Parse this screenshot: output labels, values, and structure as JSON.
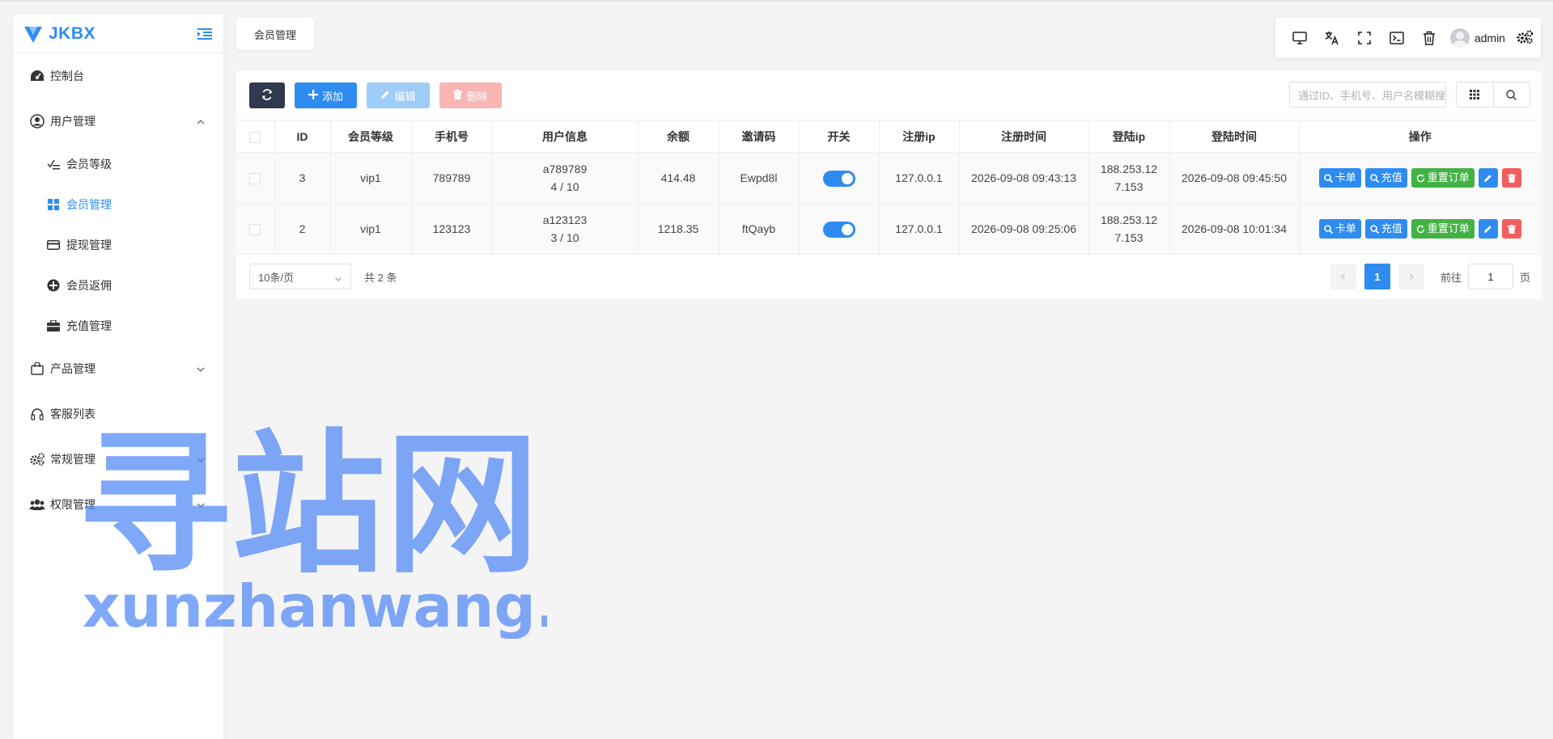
{
  "brand": {
    "name": "JKBX"
  },
  "sidebar": {
    "items": [
      {
        "label": "控制台",
        "icon": "dashboard-icon"
      },
      {
        "label": "用户管理",
        "icon": "user-circle-icon",
        "expanded": true,
        "children": [
          {
            "label": "会员等级",
            "icon": "checklist-icon"
          },
          {
            "label": "会员管理",
            "icon": "grid-icon",
            "active": true
          },
          {
            "label": "提现管理",
            "icon": "card-icon"
          },
          {
            "label": "会员返佣",
            "icon": "plus-circle-icon"
          },
          {
            "label": "充值管理",
            "icon": "briefcase-icon"
          }
        ]
      },
      {
        "label": "产品管理",
        "icon": "shopping-bag-icon"
      },
      {
        "label": "客服列表",
        "icon": "headset-icon"
      },
      {
        "label": "常规管理",
        "icon": "gears-icon"
      },
      {
        "label": "权限管理",
        "icon": "users-icon"
      }
    ]
  },
  "tab": {
    "label": "会员管理"
  },
  "header": {
    "username": "admin"
  },
  "toolbar": {
    "add_label": "添加",
    "edit_label": "编辑",
    "delete_label": "删除"
  },
  "search": {
    "placeholder": "通过ID、手机号、用户名模糊搜索"
  },
  "table": {
    "columns": [
      "ID",
      "会员等级",
      "手机号",
      "用户信息",
      "余额",
      "邀请码",
      "开关",
      "注册ip",
      "注册时间",
      "登陆ip",
      "登陆时间",
      "操作"
    ],
    "rows": [
      {
        "id": "3",
        "level": "vip1",
        "phone": "789789",
        "user_name": "a789789",
        "user_sub": "4 / 10",
        "balance": "414.48",
        "invite": "Ewpd8l",
        "enabled": true,
        "reg_ip": "127.0.0.1",
        "reg_time": "2026-09-08 09:43:13",
        "login_ip_1": "188.253.12",
        "login_ip_2": "7.153",
        "login_time": "2026-09-08 09:45:50"
      },
      {
        "id": "2",
        "level": "vip1",
        "phone": "123123",
        "user_name": "a123123",
        "user_sub": "3 / 10",
        "balance": "1218.35",
        "invite": "ftQayb",
        "enabled": true,
        "reg_ip": "127.0.0.1",
        "reg_time": "2026-09-08 09:25:06",
        "login_ip_1": "188.253.12",
        "login_ip_2": "7.153",
        "login_time": "2026-09-08 10:01:34"
      }
    ],
    "ops": {
      "card": "卡单",
      "recharge": "充值",
      "reset": "重置订单"
    }
  },
  "pagination": {
    "page_size": "10条/页",
    "total": "共 2 条",
    "current": "1",
    "goto_label": "前往",
    "goto_value": "1",
    "page_suffix": "页"
  },
  "watermark": {
    "line1": "寻站网",
    "line2": "xunzhanwang.com"
  },
  "colors": {
    "primary": "#2e8cf0",
    "dark": "#2f3a4e",
    "success": "#43b244",
    "danger": "#f25e5e"
  }
}
